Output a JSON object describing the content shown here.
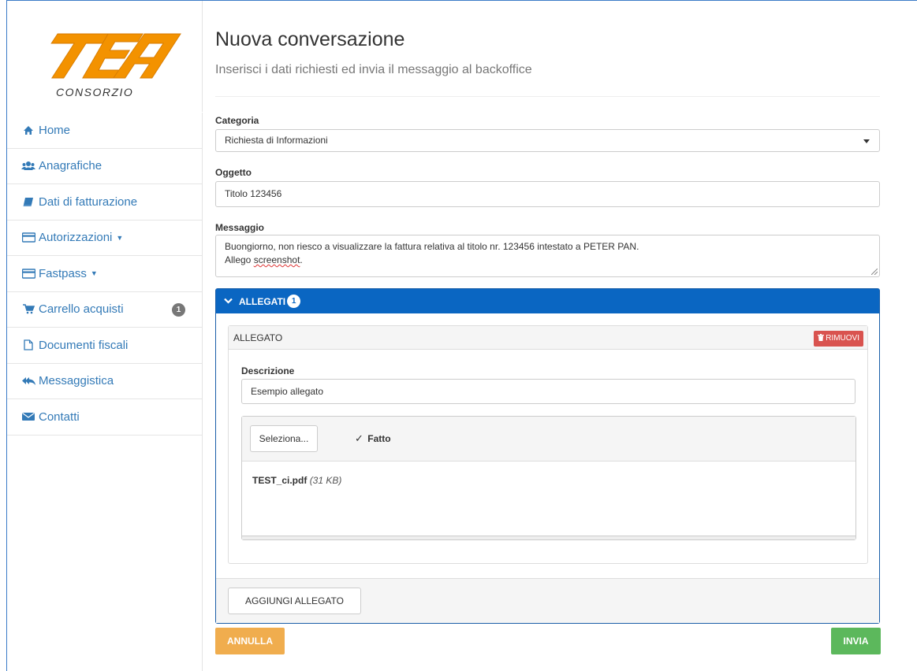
{
  "brand": {
    "logo_text": "TEA",
    "logo_subtext": "CONSORZIO",
    "logo_color": "#f39200"
  },
  "sidebar": {
    "items": [
      {
        "label": "Home",
        "icon": "home-icon"
      },
      {
        "label": "Anagrafiche",
        "icon": "users-icon"
      },
      {
        "label": "Dati di fatturazione",
        "icon": "book-icon"
      },
      {
        "label": "Autorizzazioni",
        "icon": "card-icon",
        "dropdown": true
      },
      {
        "label": "Fastpass",
        "icon": "card-icon",
        "dropdown": true
      },
      {
        "label": "Carrello acquisti",
        "icon": "cart-icon",
        "badge": "1"
      },
      {
        "label": "Documenti fiscali",
        "icon": "file-icon"
      },
      {
        "label": "Messaggistica",
        "icon": "reply-all-icon"
      },
      {
        "label": "Contatti",
        "icon": "envelope-icon"
      }
    ]
  },
  "header": {
    "title": "Nuova conversazione",
    "subtitle": "Inserisci i dati richiesti ed invia il messaggio al backoffice"
  },
  "form": {
    "categoria_label": "Categoria",
    "categoria_value": "Richiesta di Informazioni",
    "oggetto_label": "Oggetto",
    "oggetto_value": "Titolo 123456",
    "messaggio_label": "Messaggio",
    "messaggio_line1": "Buongiorno, non riesco a visualizzare la fattura relativa al titolo nr. 123456 intestato a PETER PAN.",
    "messaggio_line2_prefix": "Allego ",
    "messaggio_line2_word": "screenshot",
    "messaggio_line2_suffix": "."
  },
  "allegati": {
    "header_label": "ALLEGATI",
    "count": "1",
    "item": {
      "title": "ALLEGATO",
      "remove_label": "RIMUOVI",
      "descrizione_label": "Descrizione",
      "descrizione_value": "Esempio allegato",
      "select_label": "Seleziona...",
      "status_label": "Fatto",
      "file_name": "TEST_ci.pdf",
      "file_size": "(31 KB)"
    },
    "add_label": "AGGIUNGI ALLEGATO"
  },
  "actions": {
    "cancel_label": "ANNULLA",
    "submit_label": "INVIA"
  },
  "colors": {
    "primary": "#0a66c2",
    "link": "#337ab7",
    "danger": "#d9534f",
    "warning": "#f0ad4e",
    "success": "#5cb85c"
  }
}
